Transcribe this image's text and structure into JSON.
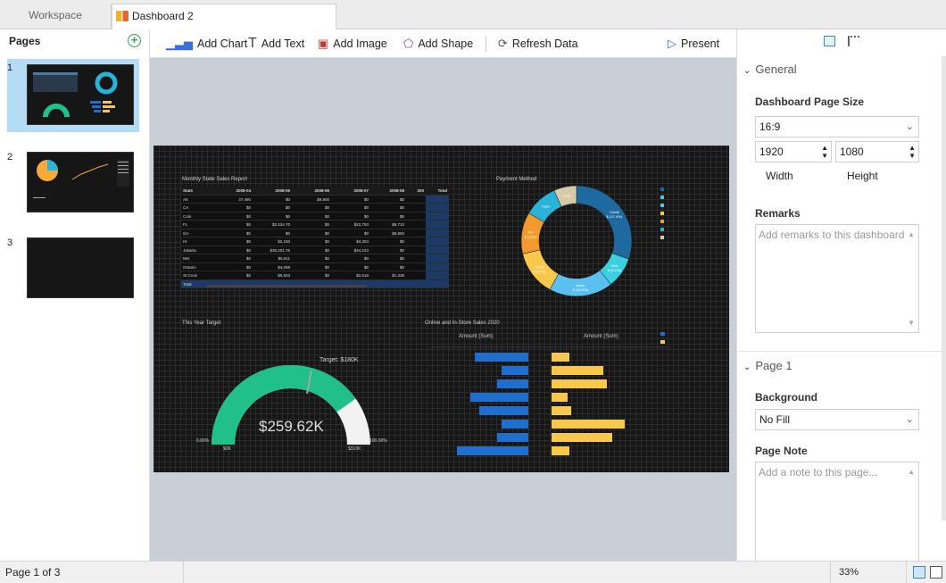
{
  "tabs": {
    "workspace": "Workspace",
    "dashboard": "Dashboard 2"
  },
  "pages": {
    "header": "Pages",
    "items": [
      {
        "num": "1"
      },
      {
        "num": "2"
      },
      {
        "num": "3"
      }
    ]
  },
  "toolbar": {
    "add_chart": "Add Chart",
    "add_text": "Add Text",
    "add_image": "Add Image",
    "add_shape": "Add Shape",
    "refresh": "Refresh Data",
    "present": "Present"
  },
  "dashboard": {
    "table_title": "Monthly State Sales Report",
    "table_headers": [
      "State",
      "2008-04",
      "2008-05",
      "2008-06",
      "2008-07",
      "2008-08",
      "200",
      "Total"
    ],
    "table_rows": [
      [
        "AK",
        "37,490",
        "$0",
        "$9,800",
        "$0",
        "$0",
        "",
        ""
      ],
      [
        "CA",
        "$0",
        "$0",
        "$0",
        "$0",
        "$0",
        "",
        ""
      ],
      [
        "Colo",
        "$0",
        "$0",
        "$0",
        "$0",
        "$0",
        "",
        ""
      ],
      [
        "FL",
        "$0",
        "$2,434.70",
        "$0",
        "$22,793",
        "$8,710",
        "",
        ""
      ],
      [
        "GA",
        "$0",
        "$0",
        "$0",
        "$0",
        "$8,893",
        "",
        ""
      ],
      [
        "HI",
        "$0",
        "$2,150",
        "$0",
        "$4,304",
        "$0",
        "",
        ""
      ],
      [
        "Jakarta",
        "$0",
        "$35,201.76",
        "$0",
        "$44,243",
        "$0",
        "",
        ""
      ],
      [
        "NM",
        "$0",
        "$6,611",
        "$0",
        "$0",
        "$0",
        "",
        ""
      ],
      [
        "Ontario",
        "$0",
        "$4,098",
        "$0",
        "$0",
        "$0",
        "",
        ""
      ],
      [
        "St Croix",
        "$0",
        "$5,603",
        "$0",
        "$2,518",
        "$1,338",
        "",
        ""
      ],
      [
        "Total",
        "",
        "",
        "",
        "",
        "",
        "",
        ""
      ]
    ],
    "payment_title": "Payment Method",
    "donut_labels": {
      "credit": "Credit\n$ (27.4%)",
      "visa": "Visa\n$ (8.2%)",
      "amex": "Amex\n$ (16.9%)",
      "check": "Check\n$ (12%)",
      "cash": "Cash",
      "po": "PO\n$ (11%)",
      "cod": "COD"
    },
    "target_title": "This Year Target",
    "target_label": "Target: $180K",
    "gauge_value": "$259.62K",
    "gauge_min_label": "$0K",
    "gauge_max_label": "$310K",
    "gauge_left_pct": "0.00%",
    "gauge_right_pct": "100.00%",
    "sales_title": "Online and In-Store Sales 2020",
    "sales_left_axis": "Amount (Sum)",
    "sales_right_axis": "Amount (Sum)"
  },
  "props": {
    "general": "General",
    "page_size_label": "Dashboard Page Size",
    "page_size_value": "16:9",
    "width_value": "1920",
    "height_value": "1080",
    "width_label": "Width",
    "height_label": "Height",
    "remarks_label": "Remarks",
    "remarks_placeholder": "Add remarks to this dashboard",
    "page_section": "Page 1",
    "background_label": "Background",
    "background_value": "No Fill",
    "page_note_label": "Page Note",
    "page_note_placeholder": "Add a note to this page..."
  },
  "status": {
    "pages": "Page 1 of 3",
    "zoom": "33%"
  },
  "colors": {
    "accent": "#3b86d0",
    "gauge_green": "#21c08a",
    "bar_blue": "#1f6fd1",
    "bar_yellow": "#f7c84a",
    "canvas_bg": "#c9cfd6"
  }
}
